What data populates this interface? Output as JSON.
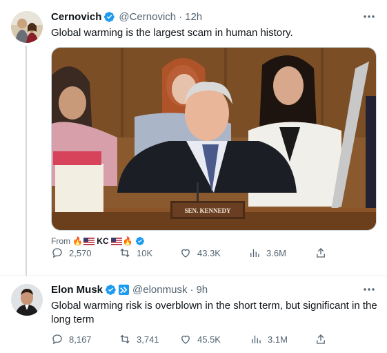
{
  "tweets": [
    {
      "name": "Cernovich",
      "handle": "@Cernovich",
      "separator": "·",
      "time": "12h",
      "text": "Global warming is the largest scam in human history.",
      "media": {
        "nameplate": "SEN. KENNEDY"
      },
      "from_label": "From",
      "from_user": "KC",
      "stats": {
        "replies": "2,570",
        "retweets": "10K",
        "likes": "43.3K",
        "views": "3.6M"
      },
      "icons": [
        "verified-badge-icon",
        "more-icon",
        "fire-emoji",
        "us-flag"
      ]
    },
    {
      "name": "Elon Musk",
      "handle": "@elonmusk",
      "separator": "·",
      "time": "9h",
      "text": "Global warming risk is overblown in the short term, but significant in the long term",
      "stats": {
        "replies": "8,167",
        "retweets": "3,741",
        "likes": "45.5K",
        "views": "3.1M"
      },
      "icons": [
        "verified-badge-icon",
        "affiliate-badge-icon",
        "more-icon"
      ]
    }
  ],
  "colors": {
    "verified": "#1d9bf0",
    "text_primary": "#0f1419",
    "text_secondary": "#536471",
    "divider": "#eff3f4"
  }
}
